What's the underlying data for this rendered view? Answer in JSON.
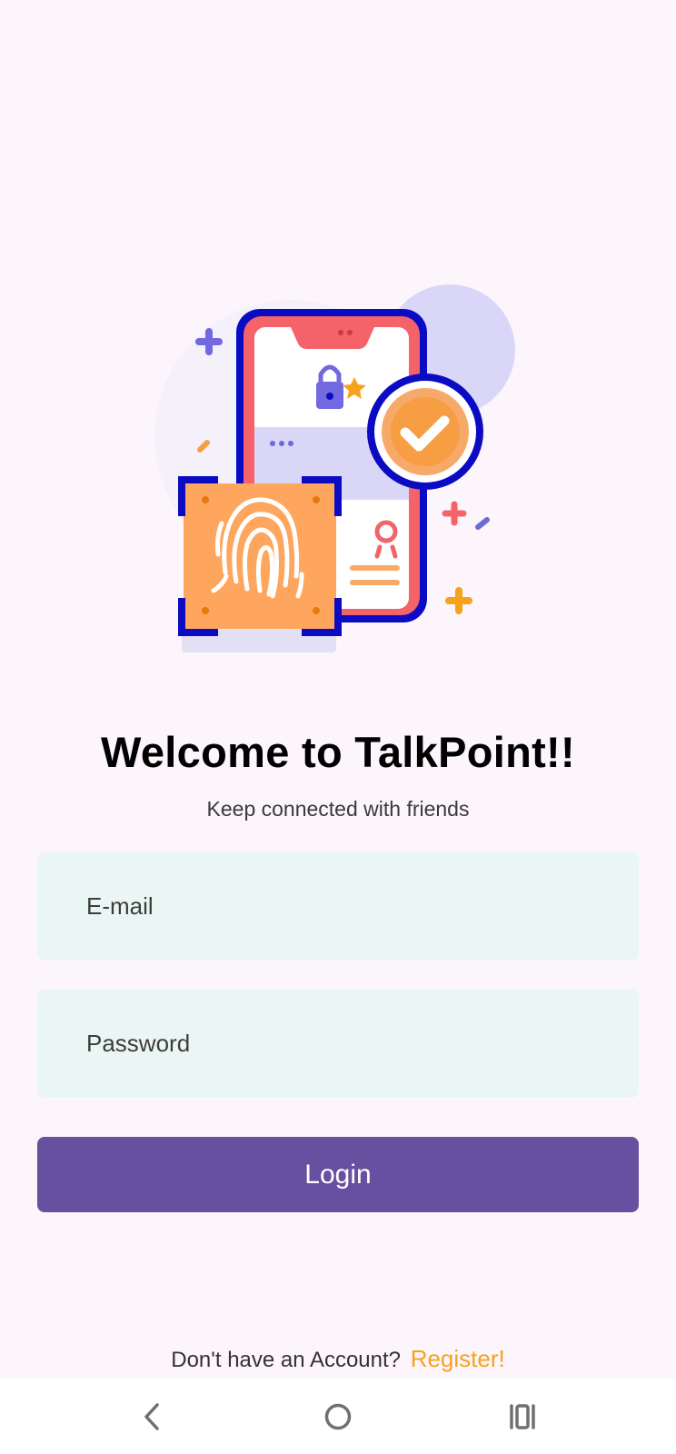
{
  "app": {
    "title": "Welcome to TalkPoint!!",
    "subtitle": "Keep connected with friends"
  },
  "form": {
    "email": {
      "placeholder": "E-mail",
      "value": ""
    },
    "password": {
      "placeholder": "Password",
      "value": ""
    },
    "login_label": "Login"
  },
  "footer": {
    "prompt": "Don't have an Account?",
    "register_label": "Register!"
  },
  "navbar": {
    "back_icon": "back-icon",
    "home_icon": "home-icon",
    "recent_icon": "recent-apps-icon"
  },
  "illustration": {
    "icon": "fingerprint-phone-security-illustration"
  },
  "colors": {
    "background": "#FCF5FC",
    "field": "#EAF6F4",
    "primary": "#6850A1",
    "accent": "#F7A21B",
    "title": "#000000"
  }
}
